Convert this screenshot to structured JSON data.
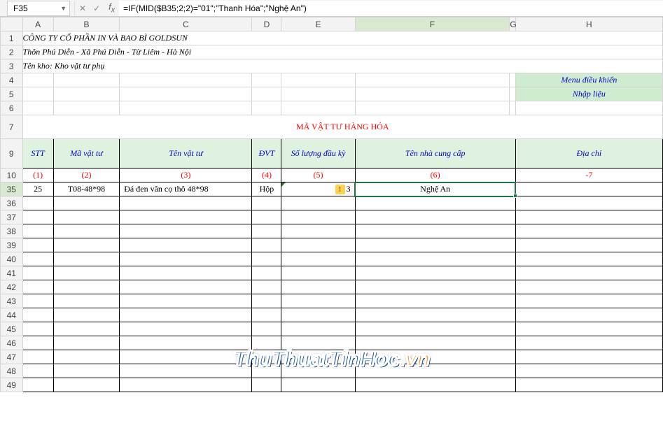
{
  "nameBox": "F35",
  "formula": "=IF(MID($B35;2;2)=\"01\";\"Thanh Hóa\";\"Nghệ An\")",
  "cols": [
    "A",
    "B",
    "C",
    "D",
    "E",
    "F",
    "G",
    "H"
  ],
  "rows_top": [
    "1",
    "2",
    "3",
    "4",
    "5",
    "6",
    "7"
  ],
  "rows_hdr": [
    "9",
    "10"
  ],
  "rows_data": [
    "35",
    "36",
    "37",
    "38",
    "39",
    "40",
    "41",
    "42",
    "43",
    "44",
    "45",
    "46",
    "47",
    "48",
    "49"
  ],
  "company": "CÔNG TY CỔ PHẦN IN VÀ BAO BÌ GOLDSUN",
  "address": "Thôn Phú Diễn - Xã Phú Diễn - Từ Liêm - Hà Nội",
  "kho": "Tên kho: Kho vật tư phụ",
  "buttons": {
    "menu": "Menu điều khiển",
    "nhap": "Nhập liệu"
  },
  "title": "MÃ VẬT TƯ HÀNG HÓA",
  "headers": {
    "stt": "STT",
    "ma": "Mã vật tư",
    "ten": "Tên vật tư",
    "dvt": "ĐVT",
    "sl": "Số lượng đầu kỳ",
    "ncc": "Tên nhà cung cấp",
    "dc": "Địa chỉ"
  },
  "subs": {
    "c1": "(1)",
    "c2": "(2)",
    "c3": "(3)",
    "c4": "(4)",
    "c5": "(5)",
    "c6": "(6)",
    "c7": "-7"
  },
  "row": {
    "stt": "25",
    "ma": "T08-48*98",
    "ten": "Đá đen vân cọ thô 48*98",
    "dvt": "Hộp",
    "sl": "3",
    "ncc": "Nghệ An",
    "dc": ""
  },
  "watermark": {
    "a": "ThuThuatTinHoc",
    "b": ".vn"
  }
}
